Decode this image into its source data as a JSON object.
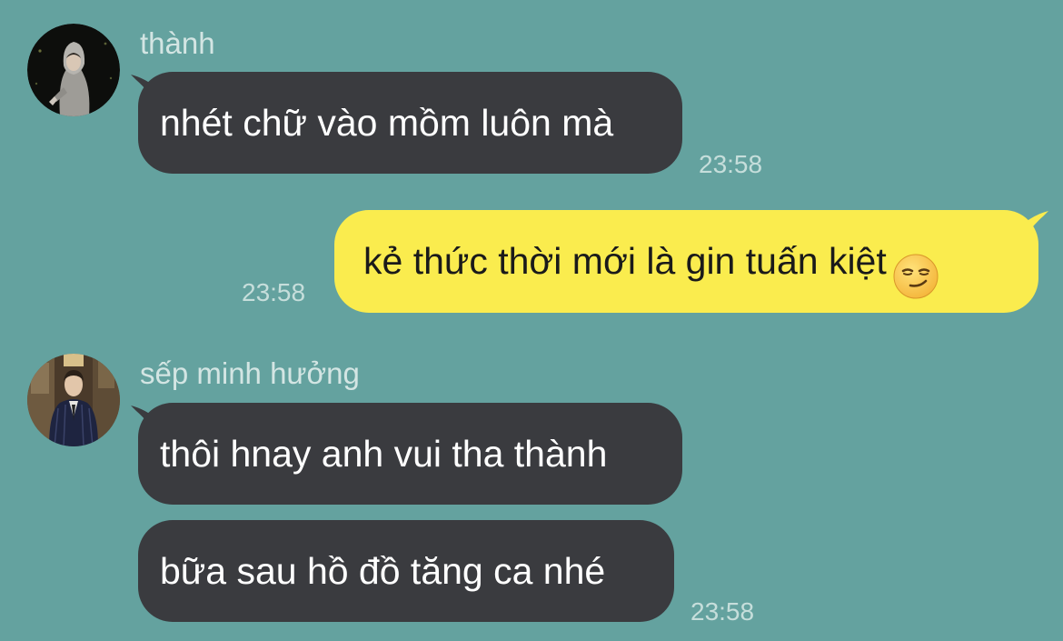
{
  "colors": {
    "background": "#64A29F",
    "incoming_bubble": "#3A3B3F",
    "outgoing_bubble": "#FAEC4E",
    "timestamp": "#C6DEDB",
    "sender_name": "#D3E5E3"
  },
  "thread": {
    "group1": {
      "sender": "thành",
      "avatar_icon": "hooded-person-avatar",
      "messages": [
        "nhét chữ vào mồm luôn mà"
      ],
      "time": "23:58"
    },
    "outgoing": {
      "text": "kẻ thức thời mới là gin tuấn kiệt",
      "emoji": "smirking-face-emoji",
      "time": "23:58"
    },
    "group2": {
      "sender": "sếp minh hưởng",
      "avatar_icon": "man-in-suit-avatar",
      "messages": [
        "thôi hnay anh vui tha thành",
        "bữa sau hồ đồ tăng ca nhé"
      ],
      "time": "23:58"
    }
  }
}
